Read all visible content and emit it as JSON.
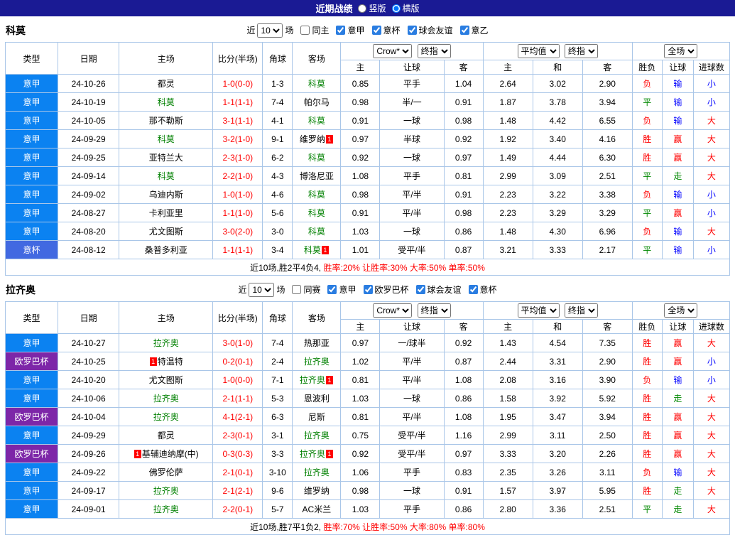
{
  "header": {
    "title": "近期战绩",
    "layout_options": [
      {
        "label": "竖版",
        "checked": false
      },
      {
        "label": "横版",
        "checked": true
      }
    ]
  },
  "labels": {
    "near": "近",
    "games": "场",
    "card": "1"
  },
  "columns": {
    "type": "类型",
    "date": "日期",
    "home": "主场",
    "score": "比分(半场)",
    "corner": "角球",
    "away": "客场",
    "odds_home": "主",
    "odds_handicap": "让球",
    "odds_away": "客",
    "avg_home": "主",
    "avg_draw": "和",
    "avg_away": "客",
    "result": "胜负",
    "handicap_result": "让球",
    "goals": "进球数"
  },
  "dropdowns": {
    "company": "Crow*",
    "final": "终指",
    "average": "平均值",
    "fullmatch": "全场"
  },
  "colors": {
    "topbar_bg": "#1a1a94",
    "border": "#a9c6e8",
    "focus_team": "#008000",
    "score": "#ff0000",
    "summary": "#ff0000",
    "card_bg": "#ff0000",
    "leagues": {
      "意甲": "#0b82f1",
      "意杯": "#4169e1",
      "欧罗巴杯": "#7d26a8"
    },
    "text": {
      "red": "#ff0000",
      "green": "#008800",
      "blue": "#0000ff"
    }
  },
  "sections": [
    {
      "team": "科莫",
      "filters": {
        "count": "10",
        "same_label": "同主",
        "same_checked": false,
        "leagues": [
          {
            "label": "意甲",
            "checked": true
          },
          {
            "label": "意杯",
            "checked": true
          },
          {
            "label": "球会友谊",
            "checked": true
          },
          {
            "label": "意乙",
            "checked": true
          }
        ]
      },
      "rows": [
        {
          "league": "意甲",
          "date": "24-10-26",
          "home": "都灵",
          "score": "1-0(0-0)",
          "corner": "1-3",
          "away": "科莫",
          "away_focus": true,
          "odds": [
            "0.85",
            "平手",
            "1.04"
          ],
          "avg": [
            "2.64",
            "3.02",
            "2.90"
          ],
          "results": [
            "负",
            "输",
            "小"
          ],
          "result_colors": [
            "red",
            "blue",
            "blue"
          ]
        },
        {
          "league": "意甲",
          "date": "24-10-19",
          "home": "科莫",
          "home_focus": true,
          "score": "1-1(1-1)",
          "corner": "7-4",
          "away": "帕尔马",
          "odds": [
            "0.98",
            "半/一",
            "0.91"
          ],
          "avg": [
            "1.87",
            "3.78",
            "3.94"
          ],
          "results": [
            "平",
            "输",
            "小"
          ],
          "result_colors": [
            "green",
            "blue",
            "blue"
          ]
        },
        {
          "league": "意甲",
          "date": "24-10-05",
          "home": "那不勒斯",
          "score": "3-1(1-1)",
          "corner": "4-1",
          "away": "科莫",
          "away_focus": true,
          "odds": [
            "0.91",
            "一球",
            "0.98"
          ],
          "avg": [
            "1.48",
            "4.42",
            "6.55"
          ],
          "results": [
            "负",
            "输",
            "大"
          ],
          "result_colors": [
            "red",
            "blue",
            "red"
          ]
        },
        {
          "league": "意甲",
          "date": "24-09-29",
          "home": "科莫",
          "home_focus": true,
          "score": "3-2(1-0)",
          "corner": "9-1",
          "away": "维罗纳",
          "away_card": "after",
          "odds": [
            "0.97",
            "半球",
            "0.92"
          ],
          "avg": [
            "1.92",
            "3.40",
            "4.16"
          ],
          "results": [
            "胜",
            "赢",
            "大"
          ],
          "result_colors": [
            "red",
            "red",
            "red"
          ]
        },
        {
          "league": "意甲",
          "date": "24-09-25",
          "home": "亚特兰大",
          "score": "2-3(1-0)",
          "corner": "6-2",
          "away": "科莫",
          "away_focus": true,
          "odds": [
            "0.92",
            "一球",
            "0.97"
          ],
          "avg": [
            "1.49",
            "4.44",
            "6.30"
          ],
          "results": [
            "胜",
            "赢",
            "大"
          ],
          "result_colors": [
            "red",
            "red",
            "red"
          ]
        },
        {
          "league": "意甲",
          "date": "24-09-14",
          "home": "科莫",
          "home_focus": true,
          "score": "2-2(1-0)",
          "corner": "4-3",
          "away": "博洛尼亚",
          "odds": [
            "1.08",
            "平手",
            "0.81"
          ],
          "avg": [
            "2.99",
            "3.09",
            "2.51"
          ],
          "results": [
            "平",
            "走",
            "大"
          ],
          "result_colors": [
            "green",
            "green",
            "red"
          ]
        },
        {
          "league": "意甲",
          "date": "24-09-02",
          "home": "乌迪内斯",
          "score": "1-0(1-0)",
          "corner": "4-6",
          "away": "科莫",
          "away_focus": true,
          "odds": [
            "0.98",
            "平/半",
            "0.91"
          ],
          "avg": [
            "2.23",
            "3.22",
            "3.38"
          ],
          "results": [
            "负",
            "输",
            "小"
          ],
          "result_colors": [
            "red",
            "blue",
            "blue"
          ]
        },
        {
          "league": "意甲",
          "date": "24-08-27",
          "home": "卡利亚里",
          "score": "1-1(1-0)",
          "corner": "5-6",
          "away": "科莫",
          "away_focus": true,
          "odds": [
            "0.91",
            "平/半",
            "0.98"
          ],
          "avg": [
            "2.23",
            "3.29",
            "3.29"
          ],
          "results": [
            "平",
            "赢",
            "小"
          ],
          "result_colors": [
            "green",
            "red",
            "blue"
          ]
        },
        {
          "league": "意甲",
          "date": "24-08-20",
          "home": "尤文图斯",
          "score": "3-0(2-0)",
          "corner": "3-0",
          "away": "科莫",
          "away_focus": true,
          "odds": [
            "1.03",
            "一球",
            "0.86"
          ],
          "avg": [
            "1.48",
            "4.30",
            "6.96"
          ],
          "results": [
            "负",
            "输",
            "大"
          ],
          "result_colors": [
            "red",
            "blue",
            "red"
          ]
        },
        {
          "league": "意杯",
          "date": "24-08-12",
          "home": "桑普多利亚",
          "score": "1-1(1-1)",
          "corner": "3-4",
          "away": "科莫",
          "away_focus": true,
          "away_card": "after",
          "odds": [
            "1.01",
            "受平/半",
            "0.87"
          ],
          "avg": [
            "3.21",
            "3.33",
            "2.17"
          ],
          "results": [
            "平",
            "输",
            "小"
          ],
          "result_colors": [
            "green",
            "blue",
            "blue"
          ]
        }
      ],
      "summary": {
        "record": "近10场,胜2平4负4,",
        "rates": "胜率:20% 让胜率:30% 大率:50% 单率:50%"
      }
    },
    {
      "team": "拉齐奥",
      "filters": {
        "count": "10",
        "same_label": "同赛",
        "same_checked": false,
        "leagues": [
          {
            "label": "意甲",
            "checked": true
          },
          {
            "label": "欧罗巴杯",
            "checked": true
          },
          {
            "label": "球会友谊",
            "checked": true
          },
          {
            "label": "意杯",
            "checked": true
          }
        ]
      },
      "rows": [
        {
          "league": "意甲",
          "date": "24-10-27",
          "home": "拉齐奥",
          "home_focus": true,
          "score": "3-0(1-0)",
          "corner": "7-4",
          "away": "热那亚",
          "odds": [
            "0.97",
            "一/球半",
            "0.92"
          ],
          "avg": [
            "1.43",
            "4.54",
            "7.35"
          ],
          "results": [
            "胜",
            "赢",
            "大"
          ],
          "result_colors": [
            "red",
            "red",
            "red"
          ]
        },
        {
          "league": "欧罗巴杯",
          "date": "24-10-25",
          "home": "特温特",
          "home_card": "before",
          "score": "0-2(0-1)",
          "corner": "2-4",
          "away": "拉齐奥",
          "away_focus": true,
          "odds": [
            "1.02",
            "平/半",
            "0.87"
          ],
          "avg": [
            "2.44",
            "3.31",
            "2.90"
          ],
          "results": [
            "胜",
            "赢",
            "小"
          ],
          "result_colors": [
            "red",
            "red",
            "blue"
          ]
        },
        {
          "league": "意甲",
          "date": "24-10-20",
          "home": "尤文图斯",
          "score": "1-0(0-0)",
          "corner": "7-1",
          "away": "拉齐奥",
          "away_focus": true,
          "away_card": "after",
          "odds": [
            "0.81",
            "平/半",
            "1.08"
          ],
          "avg": [
            "2.08",
            "3.16",
            "3.90"
          ],
          "results": [
            "负",
            "输",
            "小"
          ],
          "result_colors": [
            "red",
            "blue",
            "blue"
          ]
        },
        {
          "league": "意甲",
          "date": "24-10-06",
          "home": "拉齐奥",
          "home_focus": true,
          "score": "2-1(1-1)",
          "corner": "5-3",
          "away": "恩波利",
          "odds": [
            "1.03",
            "一球",
            "0.86"
          ],
          "avg": [
            "1.58",
            "3.92",
            "5.92"
          ],
          "results": [
            "胜",
            "走",
            "大"
          ],
          "result_colors": [
            "red",
            "green",
            "red"
          ]
        },
        {
          "league": "欧罗巴杯",
          "date": "24-10-04",
          "home": "拉齐奥",
          "home_focus": true,
          "score": "4-1(2-1)",
          "corner": "6-3",
          "away": "尼斯",
          "odds": [
            "0.81",
            "平/半",
            "1.08"
          ],
          "avg": [
            "1.95",
            "3.47",
            "3.94"
          ],
          "results": [
            "胜",
            "赢",
            "大"
          ],
          "result_colors": [
            "red",
            "red",
            "red"
          ]
        },
        {
          "league": "意甲",
          "date": "24-09-29",
          "home": "都灵",
          "score": "2-3(0-1)",
          "corner": "3-1",
          "away": "拉齐奥",
          "away_focus": true,
          "odds": [
            "0.75",
            "受平/半",
            "1.16"
          ],
          "avg": [
            "2.99",
            "3.11",
            "2.50"
          ],
          "results": [
            "胜",
            "赢",
            "大"
          ],
          "result_colors": [
            "red",
            "red",
            "red"
          ]
        },
        {
          "league": "欧罗巴杯",
          "date": "24-09-26",
          "home": "基辅迪纳摩(中)",
          "home_card": "before",
          "score": "0-3(0-3)",
          "corner": "3-3",
          "away": "拉齐奥",
          "away_focus": true,
          "away_card": "after",
          "odds": [
            "0.92",
            "受平/半",
            "0.97"
          ],
          "avg": [
            "3.33",
            "3.20",
            "2.26"
          ],
          "results": [
            "胜",
            "赢",
            "大"
          ],
          "result_colors": [
            "red",
            "red",
            "red"
          ]
        },
        {
          "league": "意甲",
          "date": "24-09-22",
          "home": "佛罗伦萨",
          "score": "2-1(0-1)",
          "corner": "3-10",
          "away": "拉齐奥",
          "away_focus": true,
          "odds": [
            "1.06",
            "平手",
            "0.83"
          ],
          "avg": [
            "2.35",
            "3.26",
            "3.11"
          ],
          "results": [
            "负",
            "输",
            "大"
          ],
          "result_colors": [
            "red",
            "blue",
            "red"
          ]
        },
        {
          "league": "意甲",
          "date": "24-09-17",
          "home": "拉齐奥",
          "home_focus": true,
          "score": "2-1(2-1)",
          "corner": "9-6",
          "away": "维罗纳",
          "odds": [
            "0.98",
            "一球",
            "0.91"
          ],
          "avg": [
            "1.57",
            "3.97",
            "5.95"
          ],
          "results": [
            "胜",
            "走",
            "大"
          ],
          "result_colors": [
            "red",
            "green",
            "red"
          ]
        },
        {
          "league": "意甲",
          "date": "24-09-01",
          "home": "拉齐奥",
          "home_focus": true,
          "score": "2-2(0-1)",
          "corner": "5-7",
          "away": "AC米兰",
          "odds": [
            "1.03",
            "平手",
            "0.86"
          ],
          "avg": [
            "2.80",
            "3.36",
            "2.51"
          ],
          "results": [
            "平",
            "走",
            "大"
          ],
          "result_colors": [
            "green",
            "green",
            "red"
          ]
        }
      ],
      "summary": {
        "record": "近10场,胜7平1负2,",
        "rates": "胜率:70% 让胜率:50% 大率:80% 单率:80%"
      }
    }
  ]
}
